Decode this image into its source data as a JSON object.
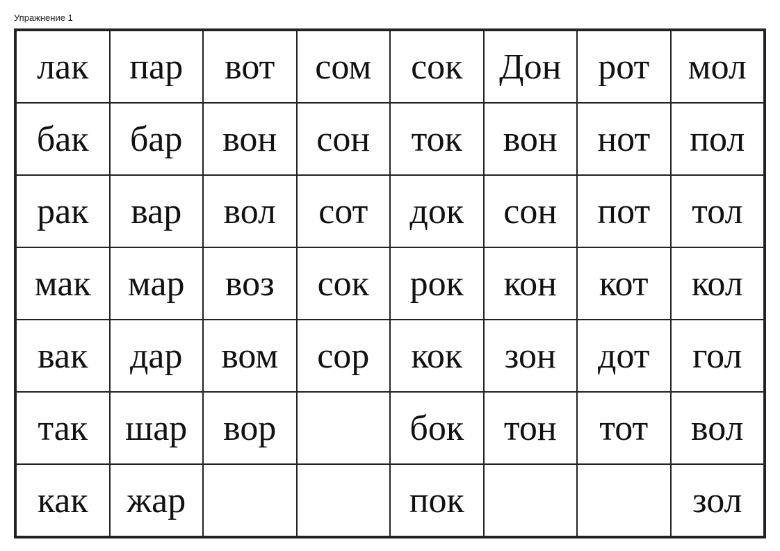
{
  "page": {
    "title": "Упражнение 1",
    "rows": [
      [
        "лак",
        "пар",
        "вот",
        "сом",
        "сок",
        "Дон",
        "рот",
        "мол"
      ],
      [
        "бак",
        "бар",
        "вон",
        "сон",
        "ток",
        "вон",
        "нот",
        "пол"
      ],
      [
        "рак",
        "вар",
        "вол",
        "сот",
        "док",
        "сон",
        "пот",
        "тол"
      ],
      [
        "мак",
        "мар",
        "воз",
        "сок",
        "рок",
        "кон",
        "кот",
        "кол"
      ],
      [
        "вак",
        "дар",
        "вом",
        "сор",
        "кок",
        "зон",
        "дот",
        "гол"
      ],
      [
        "так",
        "шар",
        "вор",
        "",
        "бок",
        "тон",
        "тот",
        "вол"
      ],
      [
        "как",
        "жар",
        "",
        "",
        "пок",
        "",
        "",
        "зол"
      ]
    ]
  }
}
